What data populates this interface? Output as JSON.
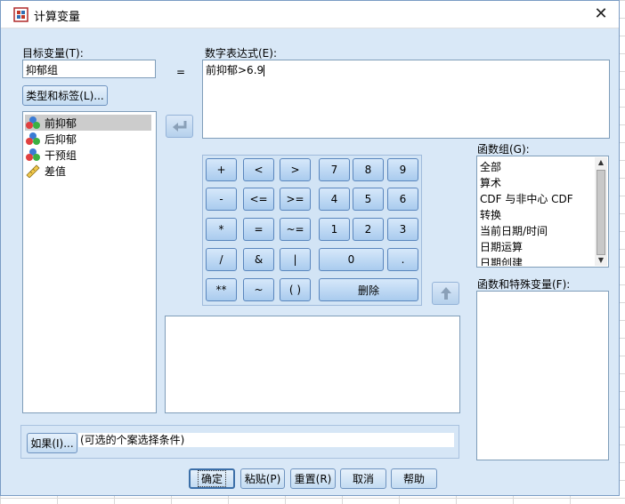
{
  "window": {
    "title": "计算变量",
    "close_glyph": "✕"
  },
  "target_variable": {
    "label": "目标变量(T):",
    "value": "抑郁组"
  },
  "equals_sign": "=",
  "type_label_button": "类型和标签(L)...",
  "variables": [
    {
      "name": "前抑郁",
      "icon": "nominal-icon",
      "selected": true
    },
    {
      "name": "后抑郁",
      "icon": "nominal-icon",
      "selected": false
    },
    {
      "name": "干预组",
      "icon": "nominal-icon",
      "selected": false
    },
    {
      "name": "差值",
      "icon": "scale-ruler-icon",
      "selected": false
    }
  ],
  "expression": {
    "label": "数字表达式(E):",
    "value": "前抑郁>6.9"
  },
  "calculator": {
    "operators": [
      [
        "+",
        "<",
        ">"
      ],
      [
        "-",
        "<=",
        ">="
      ],
      [
        "*",
        "=",
        "~="
      ],
      [
        "/",
        "&",
        "|"
      ],
      [
        "**",
        "~",
        "( )"
      ]
    ],
    "digits": [
      [
        "7",
        "8",
        "9"
      ],
      [
        "4",
        "5",
        "6"
      ],
      [
        "1",
        "2",
        "3"
      ]
    ],
    "zero": "0",
    "dot": ".",
    "delete": "删除"
  },
  "function_group": {
    "label": "函数组(G):",
    "items": [
      "全部",
      "算术",
      "CDF 与非中心 CDF",
      "转换",
      "当前日期/时间",
      "日期运算",
      "日期创建"
    ]
  },
  "functions_special": {
    "label": "函数和特殊变量(F):"
  },
  "if_button": "如果(I)...",
  "if_condition": "(可选的个案选择条件)",
  "footer_buttons": {
    "ok": "确定",
    "paste": "粘贴(P)",
    "reset": "重置(R)",
    "cancel": "取消",
    "help": "帮助"
  }
}
